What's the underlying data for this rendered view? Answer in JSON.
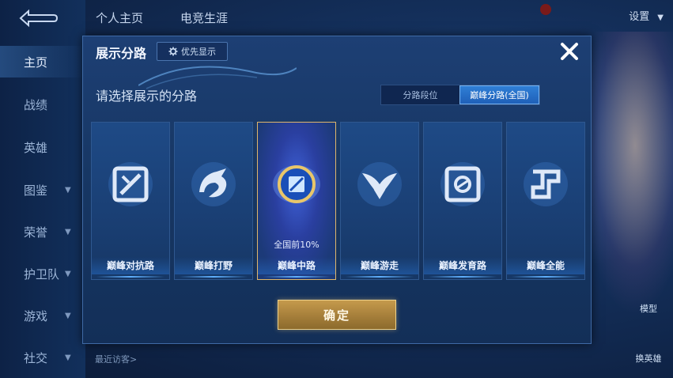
{
  "background": {
    "top_tabs": [
      "个人主页",
      "电竞生涯"
    ],
    "settings_label": "设置",
    "sidebar": [
      {
        "label": "主页",
        "active": true,
        "chevron": false
      },
      {
        "label": "战绩",
        "active": false,
        "chevron": false
      },
      {
        "label": "英雄",
        "active": false,
        "chevron": false
      },
      {
        "label": "图鉴",
        "active": false,
        "chevron": true
      },
      {
        "label": "荣誉",
        "active": false,
        "chevron": true
      },
      {
        "label": "护卫队",
        "active": false,
        "chevron": true
      },
      {
        "label": "游戏",
        "active": false,
        "chevron": true
      },
      {
        "label": "社交",
        "active": false,
        "chevron": true
      }
    ],
    "recent_visitors": "最近访客>",
    "right_buttons": [
      "模型",
      "换英雄"
    ]
  },
  "modal": {
    "title": "展示分路",
    "priority_label": "优先显示",
    "subtitle": "请选择展示的分路",
    "segments": [
      {
        "label": "分路段位",
        "active": false
      },
      {
        "label": "巅峰分路(全国)",
        "active": true
      }
    ],
    "cards": [
      {
        "label": "巅峰对抗路",
        "icon": "clash-lane-icon",
        "selected": false,
        "rank": ""
      },
      {
        "label": "巅峰打野",
        "icon": "jungle-dragon-icon",
        "selected": false,
        "rank": ""
      },
      {
        "label": "巅峰中路",
        "icon": "mid-lane-icon",
        "selected": true,
        "rank": "全国前10%"
      },
      {
        "label": "巅峰游走",
        "icon": "roam-wings-icon",
        "selected": false,
        "rank": ""
      },
      {
        "label": "巅峰发育路",
        "icon": "farm-lane-icon",
        "selected": false,
        "rank": ""
      },
      {
        "label": "巅峰全能",
        "icon": "all-round-icon",
        "selected": false,
        "rank": ""
      }
    ],
    "confirm_label": "确定"
  },
  "colors": {
    "accent": "#2f7fd6",
    "gold": "#c59a4c",
    "panel": "#173764"
  }
}
